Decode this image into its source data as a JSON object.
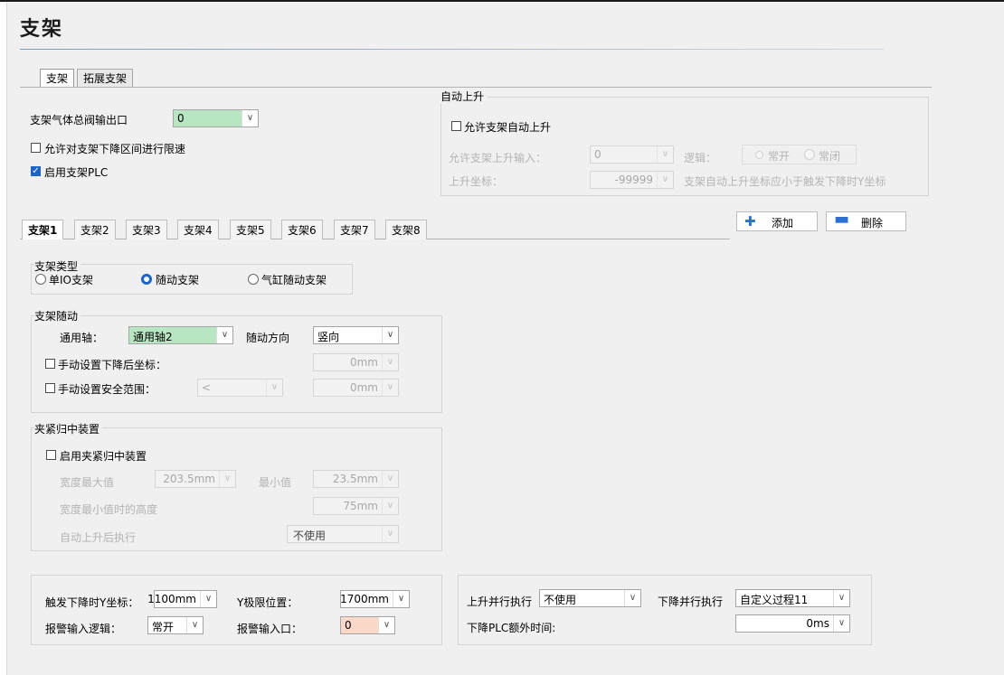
{
  "page": {
    "title": "支架"
  },
  "top_tabs": [
    "支架",
    "拓展支架"
  ],
  "general": {
    "output_label": "支架气体总阀输出口",
    "output_value": "0",
    "speed_limit_label": "允许对支架下降区间进行限速",
    "speed_limit_checked": false,
    "plc_label": "启用支架PLC",
    "plc_checked": true
  },
  "auto_rise": {
    "group_title": "自动上升",
    "allow_label": "允许支架自动上升",
    "allow_checked": false,
    "input_label": "允许支架上升输入：",
    "input_value": "0",
    "logic_label": "逻辑：",
    "logic_options": [
      "常开",
      "常闭"
    ],
    "coord_label": "上升坐标：",
    "coord_value": "-99999",
    "note": "支架自动上升坐标应小于触发下降时Y坐标"
  },
  "bracket_tabs": [
    "支架1",
    "支架2",
    "支架3",
    "支架4",
    "支架5",
    "支架6",
    "支架7",
    "支架8"
  ],
  "actions": {
    "add": "添加",
    "delete": "删除"
  },
  "bracket_type": {
    "title": "支架类型",
    "options": [
      "单IO支架",
      "随动支架",
      "气缸随动支架"
    ],
    "selected": "随动支架"
  },
  "follow": {
    "title": "支架随动",
    "axis_label": "通用轴：",
    "axis_value": "通用轴2",
    "dir_label": "随动方向",
    "dir_value": "竖向",
    "manual_coord_label": "手动设置下降后坐标：",
    "manual_coord_value": "0mm",
    "safe_range_label": "手动设置安全范围：",
    "safe_range_op": "<",
    "safe_range_value": "0mm"
  },
  "clamp": {
    "title": "夹紧归中装置",
    "enable_label": "启用夹紧归中装置",
    "max_label": "宽度最大值",
    "max_value": "203.5mm",
    "min_label": "最小值",
    "min_value": "23.5mm",
    "height_label": "宽度最小值时的高度",
    "height_value": "75mm",
    "after_label": "自动上升后执行",
    "after_value": "不使用"
  },
  "bottom_left": {
    "trigger_label": "触发下降时Y坐标：",
    "trigger_value": "1100mm",
    "ylimit_label": "Y极限位置：",
    "ylimit_value": "1700mm",
    "alarm_logic_label": "报警输入逻辑：",
    "alarm_logic_value": "常开",
    "alarm_input_label": "报警输入口：",
    "alarm_input_value": "0"
  },
  "bottom_right": {
    "rise_parallel_label": "上升并行执行",
    "rise_parallel_value": "不使用",
    "fall_parallel_label": "下降并行执行",
    "fall_parallel_value": "自定义过程11",
    "plc_extra_label": "下降PLC额外时间:",
    "plc_extra_value": "0ms"
  },
  "colors": {
    "accent": "#1e63c8",
    "green_field": "#b9e6c2",
    "orange_field": "#fbd9c8"
  }
}
